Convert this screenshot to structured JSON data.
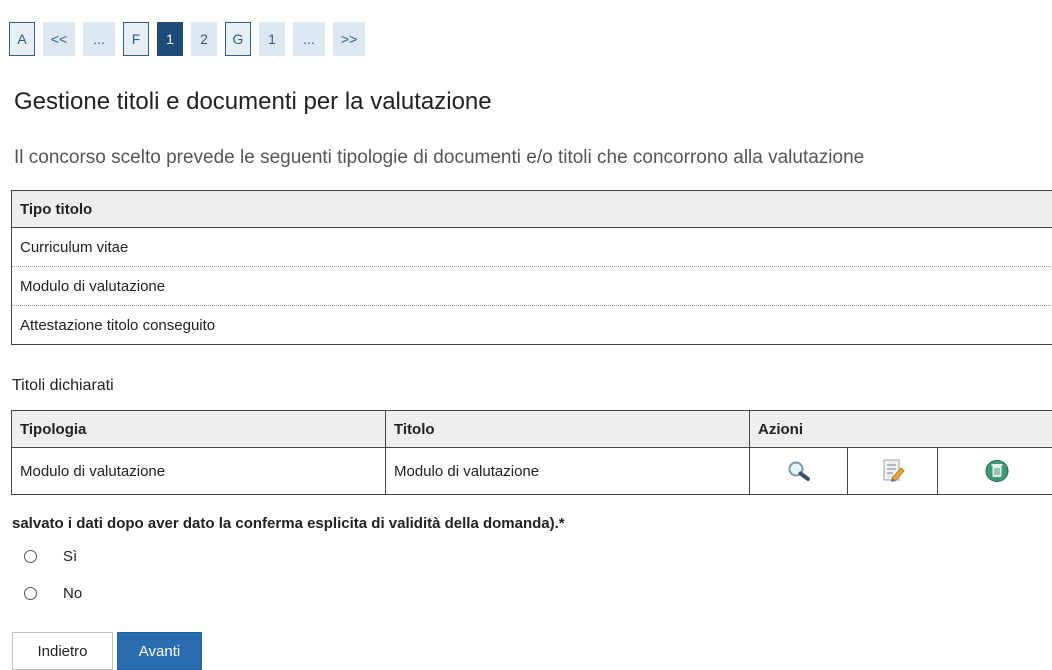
{
  "steps": [
    {
      "label": "A",
      "boxed": true
    },
    {
      "label": "<<"
    },
    {
      "label": "..."
    },
    {
      "label": "F",
      "boxed": true
    },
    {
      "label": "1",
      "active": true
    },
    {
      "label": "2"
    },
    {
      "label": "G",
      "boxed": true
    },
    {
      "label": "1"
    },
    {
      "label": "..."
    },
    {
      "label": ">>"
    }
  ],
  "page_title": "Gestione titoli e documenti per la valutazione",
  "intro": "Il concorso scelto prevede le seguenti tipologie di documenti e/o titoli che concorrono alla valutazione",
  "types_table": {
    "header": "Tipo titolo",
    "rows": [
      "Curriculum vitae",
      "Modulo di valutazione",
      "Attestazione titolo conseguito"
    ]
  },
  "declared": {
    "label": "Titoli dichiarati",
    "headers": {
      "tipologia": "Tipologia",
      "titolo": "Titolo",
      "azioni": "Azioni"
    },
    "rows": [
      {
        "tipologia": "Modulo di valutazione",
        "titolo": "Modulo di valutazione"
      }
    ],
    "actions": [
      "view-icon",
      "edit-icon",
      "delete-icon"
    ]
  },
  "question": "salvato i dati dopo aver dato la conferma esplicita di validità della domanda).*",
  "options": [
    "Sì",
    "No"
  ],
  "buttons": {
    "back": "Indietro",
    "next": "Avanti"
  },
  "colors": {
    "primary": "#2a6db3",
    "step_bg": "#dde7f1",
    "active_step": "#1e4c78"
  }
}
